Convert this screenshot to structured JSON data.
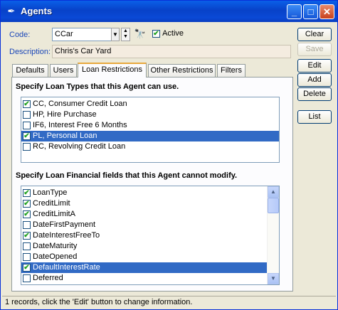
{
  "window": {
    "title": "Agents"
  },
  "form": {
    "code_label": "Code:",
    "code_value": "CCar",
    "active_label": "Active",
    "active_checked": true,
    "description_label": "Description:",
    "description_value": "Chris's Car Yard"
  },
  "buttons": {
    "clear": "Clear",
    "save": "Save",
    "edit": "Edit",
    "add": "Add",
    "delete": "Delete",
    "list": "List"
  },
  "tabs": [
    "Defaults",
    "Users",
    "Loan Restrictions",
    "Other Restrictions",
    "Filters"
  ],
  "selected_tab": "Loan Restrictions",
  "loan_types": {
    "heading": "Specify Loan Types that this Agent can use.",
    "items": [
      {
        "label": "CC, Consumer Credit Loan",
        "checked": true,
        "selected": false
      },
      {
        "label": "HP, Hire Purchase",
        "checked": false,
        "selected": false
      },
      {
        "label": "IF6, Interest Free 6 Months",
        "checked": false,
        "selected": false
      },
      {
        "label": "PL, Personal Loan",
        "checked": true,
        "selected": true
      },
      {
        "label": "RC, Revolving Credit Loan",
        "checked": false,
        "selected": false
      }
    ]
  },
  "financial_fields": {
    "heading": "Specify Loan Financial fields that this Agent cannot modify.",
    "items": [
      {
        "label": "LoanType",
        "checked": true,
        "selected": false
      },
      {
        "label": "CreditLimit",
        "checked": true,
        "selected": false
      },
      {
        "label": "CreditLimitA",
        "checked": true,
        "selected": false
      },
      {
        "label": "DateFirstPayment",
        "checked": false,
        "selected": false
      },
      {
        "label": "DateInterestFreeTo",
        "checked": true,
        "selected": false
      },
      {
        "label": "DateMaturity",
        "checked": false,
        "selected": false
      },
      {
        "label": "DateOpened",
        "checked": false,
        "selected": false
      },
      {
        "label": "DefaultInterestRate",
        "checked": true,
        "selected": true
      },
      {
        "label": "Deferred",
        "checked": false,
        "selected": false
      }
    ]
  },
  "status": "1 records, click the 'Edit' button to change information.",
  "colors": {
    "accent": "#316ac5",
    "label_blue": "#1a46b8",
    "titlebar": "#0842c8",
    "tab_highlight": "#e8a83c"
  },
  "icons": {
    "app": "agents-app-icon",
    "search": "binoculars-icon",
    "min": "minimize-icon",
    "max": "maximize-icon",
    "close": "close-icon"
  }
}
